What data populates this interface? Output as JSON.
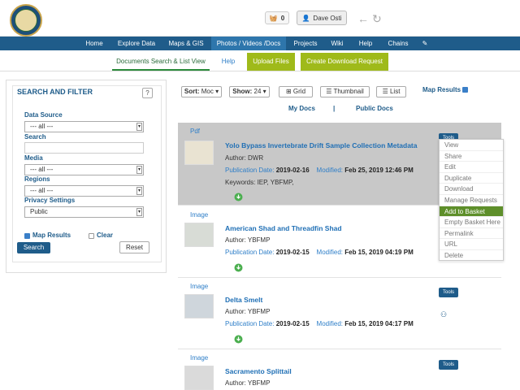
{
  "header": {
    "basket_count": "0",
    "user_name": "Dave Osti"
  },
  "nav": {
    "items": [
      "Home",
      "Explore Data",
      "Maps & GIS",
      "Photos / Videos /Docs",
      "Projects",
      "Wiki",
      "Help",
      "Chains"
    ]
  },
  "subnav": {
    "items": [
      "Documents Search & List View",
      "Help",
      "Upload Files",
      "Create Download Request"
    ]
  },
  "sidebar": {
    "title": "SEARCH AND FILTER",
    "help_glyph": "?",
    "data_source_label": "Data Source",
    "data_source_value": "--- all ---",
    "search_label": "Search",
    "search_value": "",
    "media_label": "Media",
    "media_value": "--- all ---",
    "regions_label": "Regions",
    "regions_value": "--- all ---",
    "privacy_label": "Privacy Settings",
    "privacy_value": "Public",
    "map_results_label": "Map Results",
    "clear_label": "Clear",
    "search_button": "Search",
    "reset_button": "Reset"
  },
  "toolbar": {
    "sort_label": "Sort:",
    "sort_value": "Moc",
    "show_label": "Show:",
    "show_value": "24",
    "grid_label": "Grid",
    "thumbnail_label": "Thumbnail",
    "list_label": "List",
    "map_results_label": "Map Results",
    "my_docs": "My Docs",
    "separator": "|",
    "public_docs": "Public Docs"
  },
  "results": [
    {
      "type": "Pdf",
      "title": "Yolo Bypass Invertebrate Drift Sample Collection Metadata",
      "author": "Author: DWR",
      "pub_label": "Publication Date:",
      "pub_date": "2019-02-16",
      "mod_label": "Modified:",
      "mod_date": "Feb 25, 2019 12:46 PM",
      "keywords": "Keywords: IEP, YBFMP,",
      "tools": "Tools"
    },
    {
      "type": "Image",
      "title": "American Shad and Threadfin Shad",
      "author": "Author: YBFMP",
      "pub_label": "Publication Date:",
      "pub_date": "2019-02-15",
      "mod_label": "Modified:",
      "mod_date": "Feb 15, 2019 04:19 PM",
      "tools": "Tools"
    },
    {
      "type": "Image",
      "title": "Delta Smelt",
      "author": "Author: YBFMP",
      "pub_label": "Publication Date:",
      "pub_date": "2019-02-15",
      "mod_label": "Modified:",
      "mod_date": "Feb 15, 2019 04:17 PM",
      "tools": "Tools"
    },
    {
      "type": "Image",
      "title": "Sacramento Splittail",
      "author": "Author: YBFMP",
      "tools": "Tools"
    }
  ],
  "menu": {
    "items": [
      "View",
      "Share",
      "Edit",
      "Duplicate",
      "Download",
      "Manage Requests",
      "Add to Basket",
      "Empty Basket Here",
      "Permalink",
      "URL",
      "Delete"
    ]
  }
}
